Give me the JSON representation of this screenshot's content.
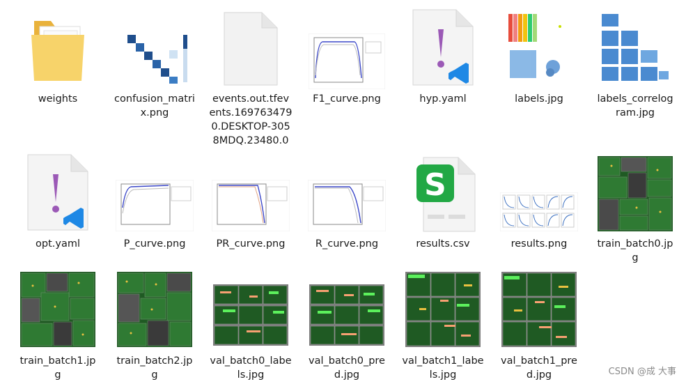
{
  "files": [
    {
      "name": "weights",
      "icon": "folder-icon"
    },
    {
      "name": "confusion_matri\nx.png",
      "icon": "confusion-matrix-thumbnail"
    },
    {
      "name": "events.out.tfev\nents.169763479\n0.DESKTOP-305\n8MDQ.23480.0",
      "icon": "blank-file-icon"
    },
    {
      "name": "F1_curve.png",
      "icon": "curve-plot-thumbnail"
    },
    {
      "name": "hyp.yaml",
      "icon": "yaml-file-icon"
    },
    {
      "name": "labels.jpg",
      "icon": "labels-plot-thumbnail"
    },
    {
      "name": "labels_correlog\nram.jpg",
      "icon": "correlogram-thumbnail"
    },
    {
      "name": "opt.yaml",
      "icon": "yaml-file-icon"
    },
    {
      "name": "P_curve.png",
      "icon": "curve-plot-thumbnail"
    },
    {
      "name": "PR_curve.png",
      "icon": "curve-plot-thumbnail"
    },
    {
      "name": "R_curve.png",
      "icon": "curve-plot-thumbnail"
    },
    {
      "name": "results.csv",
      "icon": "csv-file-icon"
    },
    {
      "name": "results.png",
      "icon": "results-plot-thumbnail"
    },
    {
      "name": "train_batch0.jp\ng",
      "icon": "image-thumbnail"
    },
    {
      "name": "train_batch1.jp\ng",
      "icon": "image-thumbnail"
    },
    {
      "name": "train_batch2.jp\ng",
      "icon": "image-thumbnail"
    },
    {
      "name": "val_batch0_labe\nls.jpg",
      "icon": "image-thumbnail"
    },
    {
      "name": "val_batch0_pre\nd.jpg",
      "icon": "image-thumbnail"
    },
    {
      "name": "val_batch1_labe\nls.jpg",
      "icon": "image-thumbnail"
    },
    {
      "name": "val_batch1_pre\nd.jpg",
      "icon": "image-thumbnail"
    }
  ],
  "watermark": "CSDN @成 大事",
  "colors": {
    "folder": "#f4c64a",
    "yaml_mark": "#9b59b6",
    "vscode": "#1e88e5",
    "csv": "#22a845",
    "grid_green": "#1f5a23"
  }
}
